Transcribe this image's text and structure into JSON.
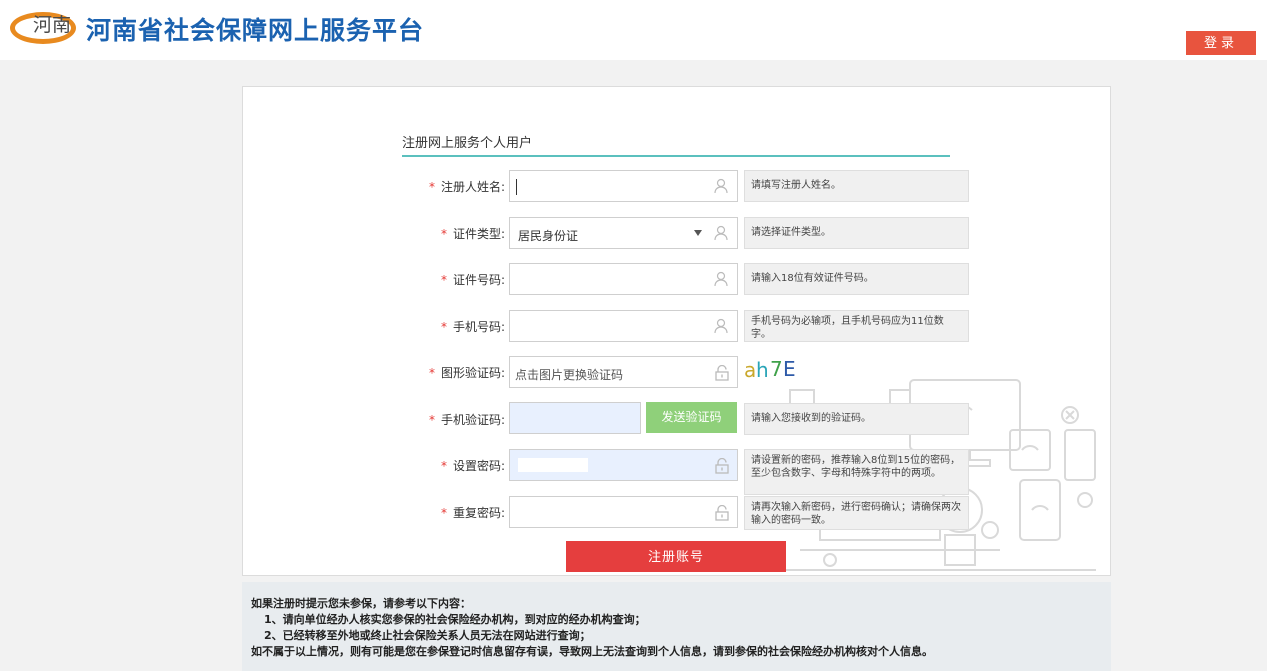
{
  "header": {
    "logo_text": "河南",
    "site_title": "河南省社会保障网上服务平台",
    "login_label": "登录"
  },
  "form": {
    "title": "注册网上服务个人用户",
    "required_mark": "*",
    "name_label": "注册人姓名:",
    "name_value": "",
    "name_tip": "请填写注册人姓名。",
    "idtype_label": "证件类型:",
    "idtype_value": "居民身份证",
    "idtype_tip": "请选择证件类型。",
    "idno_label": "证件号码:",
    "idno_value": "",
    "idno_tip": "请输入18位有效证件号码。",
    "phone_label": "手机号码:",
    "phone_value": "",
    "phone_tip": "手机号码为必输项，且手机号码应为11位数字。",
    "captcha_label": "图形验证码:",
    "captcha_placeholder": "点击图片更换验证码",
    "captcha_text": "ah7E",
    "sms_label": "手机验证码:",
    "sms_button": "发送验证码",
    "sms_tip": "请输入您接收到的验证码。",
    "pwd_label": "设置密码:",
    "pwd_tip": "请设置新的密码，推荐输入8位到15位的密码，至少包含数字、字母和特殊字符中的两项。",
    "repwd_label": "重复密码:",
    "repwd_tip": "请再次输入新密码，进行密码确认；请确保两次输入的密码一致。",
    "submit_label": "注册账号"
  },
  "notice": {
    "heading": "如果注册时提示您未参保，请参考以下内容：",
    "item1": "1、请向单位经办人核实您参保的社会保险经办机构，到对应的经办机构查询；",
    "item2": "2、已经转移至外地或终止社会保险关系人员无法在网站进行查询；",
    "footer": "如不属于以上情况，则有可能是您在参保登记时信息留存有误，导致网上无法查询到个人信息，请到参保的社会保险经办机构核对个人信息。"
  },
  "icons": {
    "user": "user-icon",
    "lock": "lock-icon",
    "dropdown": "caret-down-icon"
  },
  "colors": {
    "title_blue": "#1b62b0",
    "logo_orange": "#e88a1f",
    "login_red": "#e8543e",
    "submit_red": "#e53e3e",
    "sms_green": "#8fd07a",
    "accent_teal": "#5bc0be"
  }
}
